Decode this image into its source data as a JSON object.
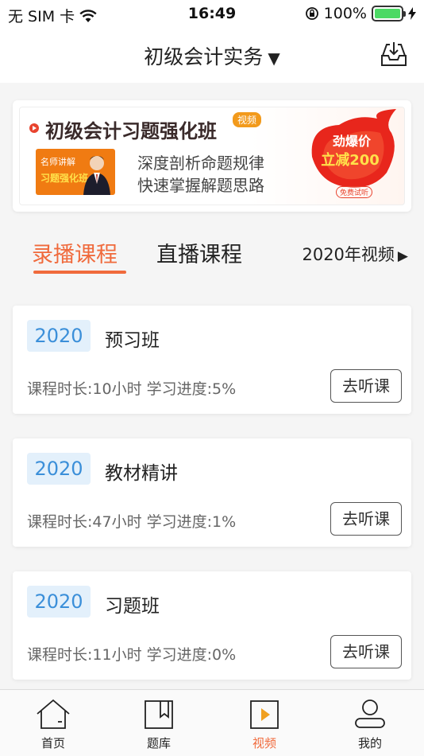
{
  "status_bar": {
    "carrier": "无 SIM 卡",
    "time": "16:49",
    "battery": "100%",
    "battery_level": 1.0
  },
  "nav": {
    "title": "初级会计实务",
    "caret": "▼",
    "download_icon": "download-tray-icon"
  },
  "banner": {
    "title": "初级会计习题强化班",
    "badge": "视频",
    "teacher_tag_line1": "名师讲解",
    "teacher_tag_line2": "习题强化班",
    "line1": "深度剖析命题规律",
    "line2": "快速掌握解题思路",
    "promo_line1": "劲爆价",
    "promo_line2": "立减200",
    "trial": "免费试听"
  },
  "tabs": {
    "items": [
      {
        "label": "录播课程",
        "active": true
      },
      {
        "label": "直播课程",
        "active": false
      }
    ],
    "year_filter": "2020年视频",
    "year_arrow": "▶"
  },
  "courses": [
    {
      "year": "2020",
      "name": "预习班",
      "meta": "课程时长:10小时  学习进度:5%",
      "button": "去听课"
    },
    {
      "year": "2020",
      "name": "教材精讲",
      "meta": "课程时长:47小时  学习进度:1%",
      "button": "去听课"
    },
    {
      "year": "2020",
      "name": "习题班",
      "meta": "课程时长:11小时  学习进度:0%",
      "button": "去听课"
    }
  ],
  "tab_bar": [
    {
      "label": "首页",
      "icon": "home-icon",
      "active": false
    },
    {
      "label": "题库",
      "icon": "bookmark-book-icon",
      "active": false
    },
    {
      "label": "视频",
      "icon": "video-play-icon",
      "active": true
    },
    {
      "label": "我的",
      "icon": "user-icon",
      "active": false
    }
  ],
  "colors": {
    "accent": "#f06a3c",
    "year_badge_text": "#3b8fd9",
    "year_badge_bg": "#e3f0fb",
    "battery_fill": "#4cd964"
  }
}
